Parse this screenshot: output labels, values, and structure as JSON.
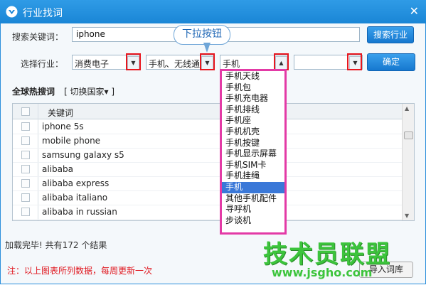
{
  "window": {
    "title": "行业找词",
    "close_glyph": "✕"
  },
  "search": {
    "label": "搜索关键词：",
    "value": "iphone",
    "button": "搜索行业"
  },
  "industry": {
    "label": "选择行业：",
    "level1": "消费电子",
    "level2": "手机、无线通",
    "level3": "手机",
    "level4": "",
    "confirm_button": "确定"
  },
  "callout": {
    "text": "下拉按钮"
  },
  "hot": {
    "title": "全球热搜词",
    "switch_country": "[ 切换国家▾ ]"
  },
  "table": {
    "header": "关键词",
    "rows": [
      "iphone 5s",
      "mobile phone",
      "samsung galaxy s5",
      "alibaba",
      "alibaba express",
      "alibaba italiano",
      "alibaba in russian"
    ]
  },
  "dropdown": {
    "options": [
      "手机天线",
      "手机包",
      "手机充电器",
      "手机排线",
      "手机座",
      "手机机壳",
      "手机按键",
      "手机显示屏幕",
      "手机SIM卡",
      "手机挂绳",
      "手机",
      "其他手机配件",
      "寻呼机",
      "步谈机"
    ],
    "selected_index": 10
  },
  "status": {
    "text": "加载完毕! 共有172 个结果"
  },
  "note": {
    "text": "注：以上图表所列数据，每周更新一次"
  },
  "import_button": {
    "label": "导入词库"
  },
  "watermark": {
    "big": "技术员联盟",
    "url": "www.jsgho.com"
  },
  "colors": {
    "title_bar": "#1a86d6",
    "highlight_red": "#e8161e",
    "dropdown_border": "#e33aa6",
    "selected_option": "#3a78d8",
    "watermark_green": "#3cc43c"
  }
}
